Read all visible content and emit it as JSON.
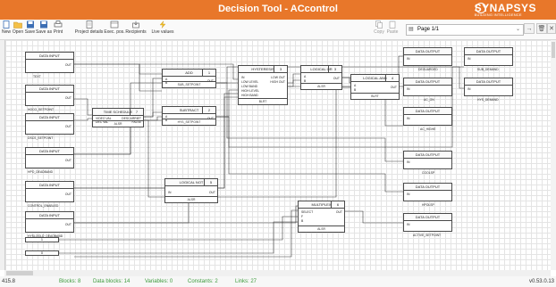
{
  "window": {
    "title": "Decision Tool - ACcontrol"
  },
  "brand": {
    "name": "SYNAPSYS",
    "tagline": "BUILDING INTELLIGENCE"
  },
  "toolbar": {
    "items": [
      {
        "label": "New"
      },
      {
        "label": "Open"
      },
      {
        "label": "Save"
      },
      {
        "label": "Save as"
      },
      {
        "label": "Print"
      },
      {
        "label": "Project details"
      },
      {
        "label": "Exec. pos."
      },
      {
        "label": "Recipients"
      },
      {
        "label": "Live values"
      }
    ],
    "copy_label": "Copy",
    "paste_label": "Paste",
    "page_select": "Page 1/1"
  },
  "blocks": {
    "inputs": [
      {
        "title": "DATA INPUT",
        "port": "OUT",
        "var": "TEXT"
      },
      {
        "title": "DATA INPUT",
        "port": "OUT",
        "var": "HOCO_SETPOINT"
      },
      {
        "title": "DATA INPUT",
        "port": "OUT",
        "var": "DSCS_SETPOINT"
      },
      {
        "title": "DATA INPUT",
        "port": "OUT",
        "var": "HPO_DEADBAND"
      },
      {
        "title": "DATA INPUT",
        "port": "OUT",
        "var": "CONTROL_ENABLED"
      },
      {
        "title": "DATA INPUT",
        "port": "OUT",
        "var": "HYSLOOLD_DEADBAND"
      }
    ],
    "schedule": {
      "title": "TIME SCHEDULE",
      "num": "7",
      "in1": "VIDEO VAL",
      "in2": "DEC VAL",
      "out1": "DESCARRIET",
      "out2": "FALSE",
      "type": "ALSR"
    },
    "add": {
      "title": "ADD",
      "num": "1",
      "in1": "A",
      "in2": "B",
      "out": "OUT",
      "var": "SUB_SETPOINT"
    },
    "subtract": {
      "title": "SUBTRACT",
      "num": "2",
      "in1": "A",
      "in2": "B",
      "out": "OUT",
      "var": "HYS_SETPOINT"
    },
    "hysteresis": {
      "title": "HYSTERESIS",
      "num": "3",
      "inputs": [
        "IN",
        "LOW LEVEL",
        "LOW BAND",
        "HIGH LEVEL",
        "HIGH BAND"
      ],
      "outputs": [
        "LOW OUT",
        "HIGH OUT"
      ],
      "type": "BLRT"
    },
    "logor": {
      "title": "LOGICAL OR",
      "num": "3",
      "in1": "A",
      "in2": "B",
      "out": "OUT",
      "type": "ALSR"
    },
    "logand": {
      "title": "LOGICAL AND",
      "num": "4",
      "in1": "A",
      "in2": "B",
      "out": "OUT",
      "type": "BLRT"
    },
    "lognot": {
      "title": "LOGICAL NOT",
      "num": "5",
      "in": "IN",
      "out": "OUT",
      "type": "ALSR"
    },
    "multiplex": {
      "title": "MULTIPLEX",
      "num": "6",
      "inputs": [
        "SELECT",
        "F",
        "B"
      ],
      "out": "OUT",
      "type": "ALSR"
    },
    "outputs": [
      {
        "title": "DATA OUTPUT",
        "port": "IN",
        "var": "DEGUARDED"
      },
      {
        "title": "DATA OUTPUT",
        "port": "IN",
        "var": "AC_ON"
      },
      {
        "title": "DATA OUTPUT",
        "port": "IN",
        "var": "AC_HIGHE"
      },
      {
        "title": "DATA OUTPUT",
        "port": "IN",
        "var": "COOLSP"
      },
      {
        "title": "DATA OUTPUT",
        "port": "IN",
        "var": "HPOLSP"
      },
      {
        "title": "DATA OUTPUT",
        "port": "IN",
        "var": "ACTIVE_SETPOINT"
      },
      {
        "title": "DATA OUTPUT",
        "port": "IN",
        "var": "SUB_DEMAND"
      },
      {
        "title": "DATA OUTPUT",
        "port": "IN",
        "var": "HYS_DEMAND"
      }
    ],
    "constants": [
      {
        "value": "1"
      },
      {
        "value": "0"
      }
    ]
  },
  "status": {
    "zoom": "415.8",
    "blocks": "Blocks: 8",
    "data_blocks": "Data blocks: 14",
    "variables": "Variables: 0",
    "constants": "Constants: 2",
    "links": "Links: 27",
    "version": "v0.53.0.13"
  }
}
